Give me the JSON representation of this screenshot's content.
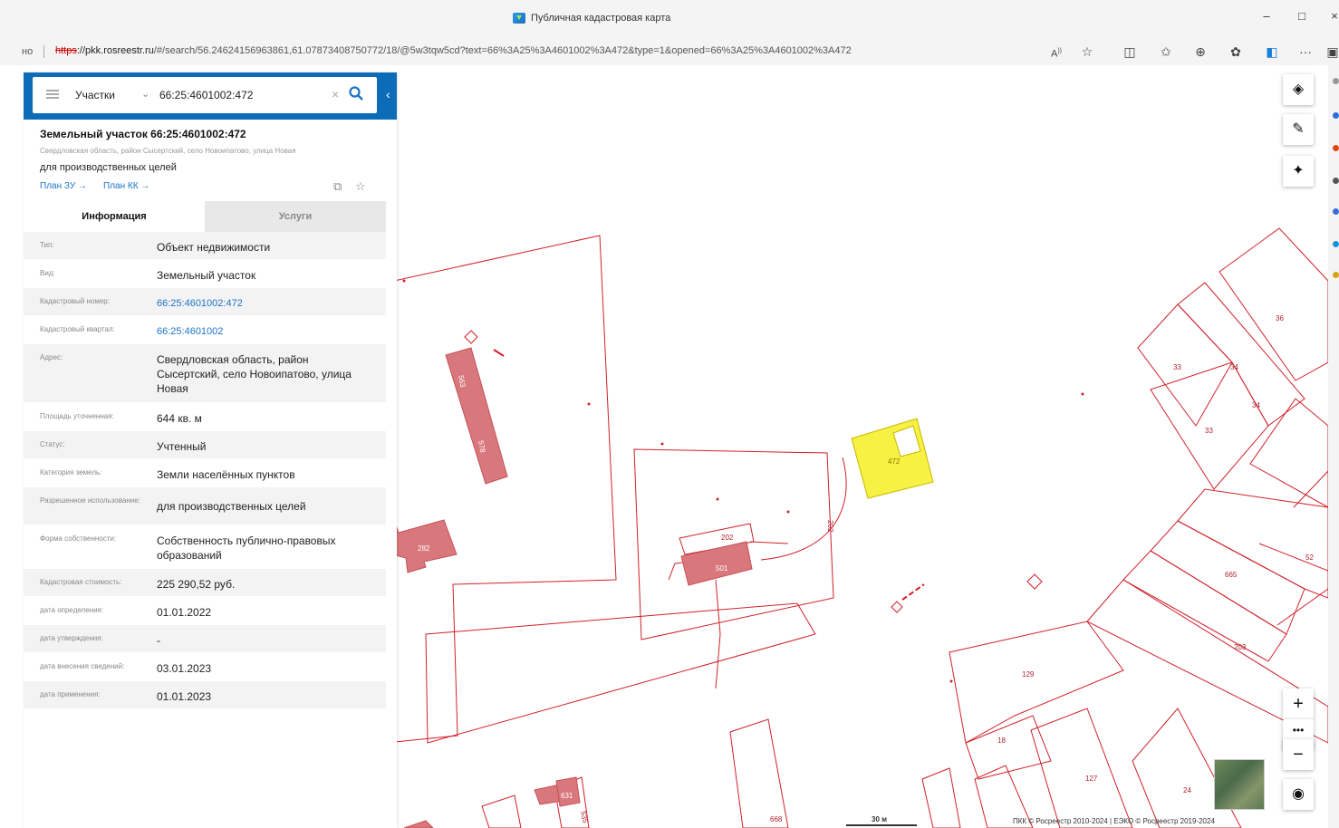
{
  "window": {
    "title": "Публичная кадастровая карта",
    "controls": [
      "–",
      "□",
      "×"
    ]
  },
  "addressbar": {
    "prefix": "но",
    "url_proto": "https",
    "url_host": "://pkk.rosreestr.ru",
    "url_rest": "/#/search/56.24624156963861,61.07873408750772/18/@5w3tqw5cd?text=66%3A25%3A4601002%3A472&type=1&opened=66%3A25%3A4601002%3A472"
  },
  "search": {
    "type_label": "Участки",
    "query": "66:25:4601002:472"
  },
  "object": {
    "title": "Земельный участок 66:25:4601002:472",
    "address_small": "Свердловская область, район Сысертский, село Новоипатово, улица Новая",
    "usage": "для производственных целей",
    "link_plan_zu": "План ЗУ →",
    "link_plan_kk": "План КК →"
  },
  "tabs": {
    "info": "Информация",
    "services": "Услуги"
  },
  "rows": [
    {
      "label": "Тип:",
      "value": "Объект недвижимости"
    },
    {
      "label": "Вид:",
      "value": "Земельный участок"
    },
    {
      "label": "Кадастровый номер:",
      "value": "66:25:4601002:472"
    },
    {
      "label": "Кадастровый квартал:",
      "value": "66:25:4601002"
    },
    {
      "label": "Адрес:",
      "value": "Свердловская область, район Сысертский, село Новоипатово, улица Новая"
    },
    {
      "label": "Площадь уточненная:",
      "value": "644 кв. м"
    },
    {
      "label": "Статус:",
      "value": "Учтенный"
    },
    {
      "label": "Категория земель:",
      "value": "Земли населённых пунктов"
    },
    {
      "label": "Разрешенное использование:",
      "value": "для производственных целей"
    },
    {
      "label": "Форма собственности:",
      "value": "Собственность публично-правовых образований"
    },
    {
      "label": "Кадастровая стоимость:",
      "value": "225 290,52 руб."
    },
    {
      "label": "дата определения:",
      "value": "01.01.2022"
    },
    {
      "label": "дата утверждения:",
      "value": "-"
    },
    {
      "label": "дата внесения сведений:",
      "value": "03.01.2023"
    },
    {
      "label": "дата применения:",
      "value": "01.01.2023"
    }
  ],
  "map": {
    "parcel_labels": [
      "472",
      "202",
      "501",
      "282",
      "36",
      "33",
      "34",
      "665",
      "52",
      "203",
      "129",
      "18",
      "127",
      "24",
      "668",
      "535",
      "631",
      "202"
    ],
    "building_labels": [
      "563",
      "578"
    ],
    "scale_label": "30 м",
    "attribution": "ПКК © Росреестр 2010-2024 | ЕЭКО © Росреестр 2019-2024",
    "colors": {
      "parcel_line": "#d0202a",
      "building_fill": "#d9787c",
      "selected_fill": "#f6f142"
    }
  }
}
